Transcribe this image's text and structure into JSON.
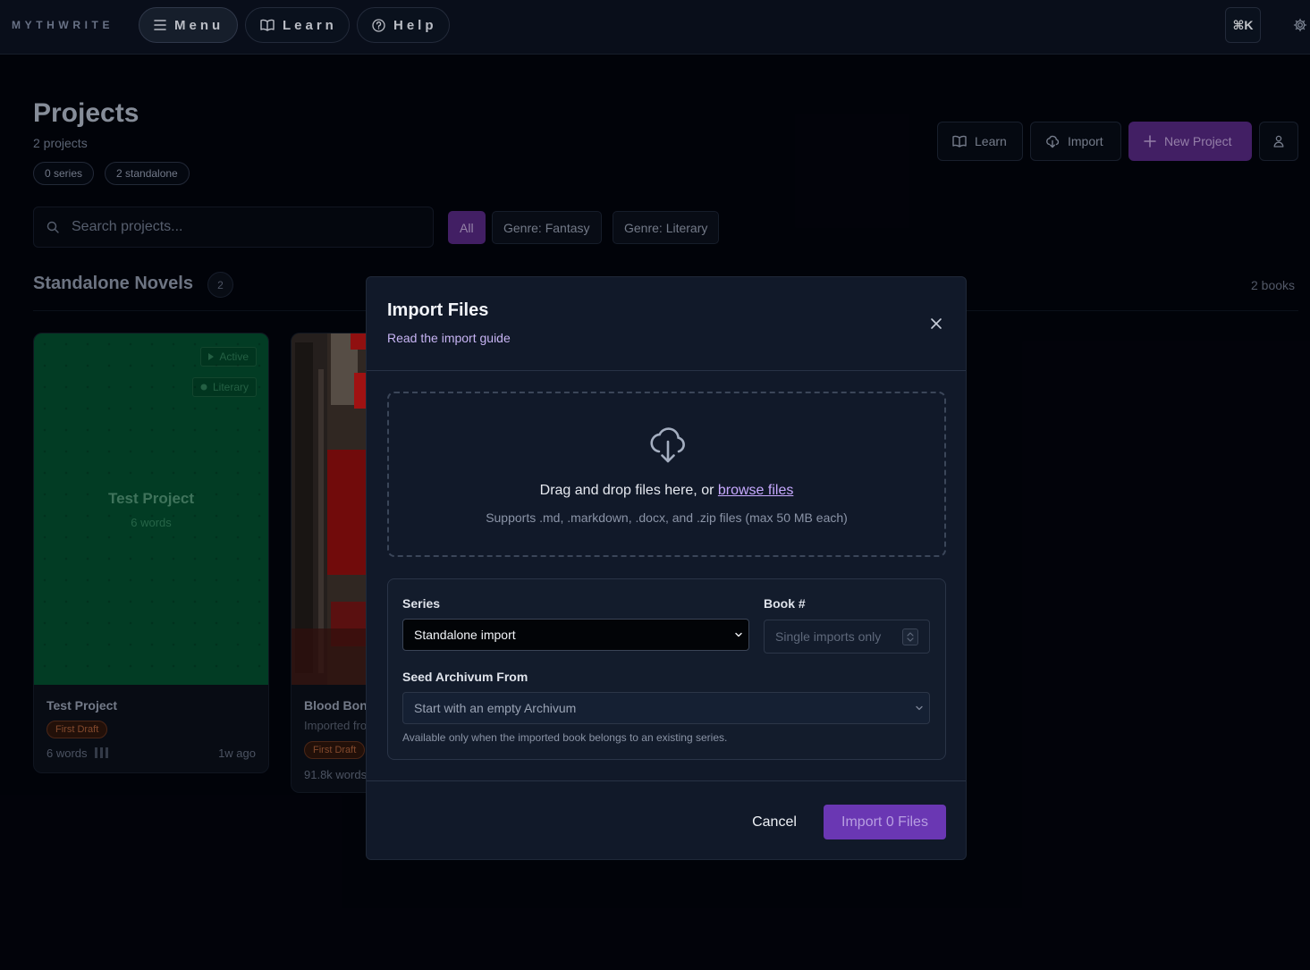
{
  "nav": {
    "brand": "MYTHWRITE",
    "menu_label": "Menu",
    "learn_label": "Learn",
    "help_label": "Help",
    "command_shortcut": "⌘K"
  },
  "page": {
    "title": "Projects",
    "subtitle": "2 projects",
    "chips": [
      "0 series",
      "2 standalone"
    ],
    "actions": {
      "learn": "Learn",
      "import": "Import",
      "new_project": "New Project"
    }
  },
  "search": {
    "placeholder": "Search projects..."
  },
  "filters": [
    "All",
    "Genre: Fantasy",
    "Genre: Literary"
  ],
  "section": {
    "title": "Standalone Novels",
    "count": "2",
    "books_count": "2 books"
  },
  "projects": [
    {
      "cover_title": "Test Project",
      "cover_words": "6 words",
      "tags": [
        "Active",
        "Literary"
      ],
      "title": "Test Project",
      "status": "First Draft",
      "words": "6 words",
      "updated": "1w ago"
    },
    {
      "title": "Blood Bon",
      "subtitle": "Imported fro",
      "status": "First Draft",
      "words": "91.8k words"
    }
  ],
  "modal": {
    "title": "Import Files",
    "guide_link": "Read the import guide",
    "dropzone": {
      "text": "Drag and drop files here, or",
      "browse": "browse files",
      "hint": "Supports .md, .markdown, .docx, and .zip files (max 50 MB each)"
    },
    "series_label": "Series",
    "series_value": "Standalone import",
    "book_label": "Book #",
    "book_placeholder": "Single imports only",
    "seed_label": "Seed Archivum From",
    "seed_value": "Start with an empty Archivum",
    "seed_note": "Available only when the imported book belongs to an existing series.",
    "cancel": "Cancel",
    "import": "Import 0 Files"
  },
  "colors": {
    "accent": "#6a37b3",
    "link": "#c7a9ff",
    "cover_green": "#034a2d"
  }
}
